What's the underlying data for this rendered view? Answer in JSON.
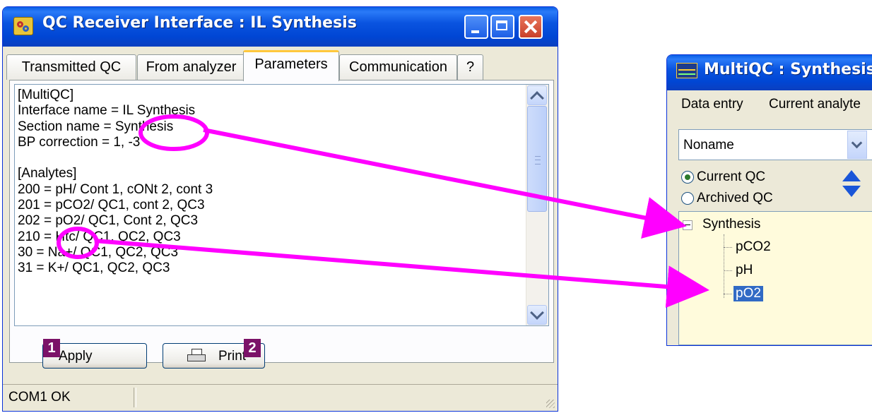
{
  "win1": {
    "title": "QC Receiver Interface : IL Synthesis",
    "tabs": [
      "Transmitted QC",
      "From analyzer",
      "Parameters",
      "Communication",
      "?"
    ],
    "active_tab": "Parameters",
    "memo_lines": [
      "[MultiQC]",
      "Interface name = IL Synthesis",
      "Section name = Synthesis",
      "BP correction = 1, -3",
      "",
      "[Analytes]",
      "200 = pH/ Cont 1, cONt 2, cont 3",
      "201 = pCO2/ QC1, cont 2, QC3",
      "202 = pO2/ QC1, Cont 2, QC3",
      "210 = Htc/ QC1, QC2, QC3",
      "30 = Na+/ QC1, QC2, QC3",
      "31 = K+/ QC1, QC2, QC3"
    ],
    "apply_label": "Apply",
    "print_label": "Print",
    "status": "COM1  OK"
  },
  "badges": {
    "one": "1",
    "two": "2"
  },
  "win2": {
    "title": "MultiQC : Synthesis",
    "menu": [
      "Data entry",
      "Current analyte"
    ],
    "combo_value": "Noname",
    "radio_current": "Current QC",
    "radio_archived": "Archived QC",
    "tree_root": "Synthesis",
    "tree_children": [
      "pCO2",
      "pH",
      "pO2"
    ],
    "selected_child": "pO2"
  },
  "colors": {
    "annotation": "#ff00ff",
    "badge": "#7b1268",
    "titlebar": "#0a54e0",
    "selection": "#316ac5"
  }
}
